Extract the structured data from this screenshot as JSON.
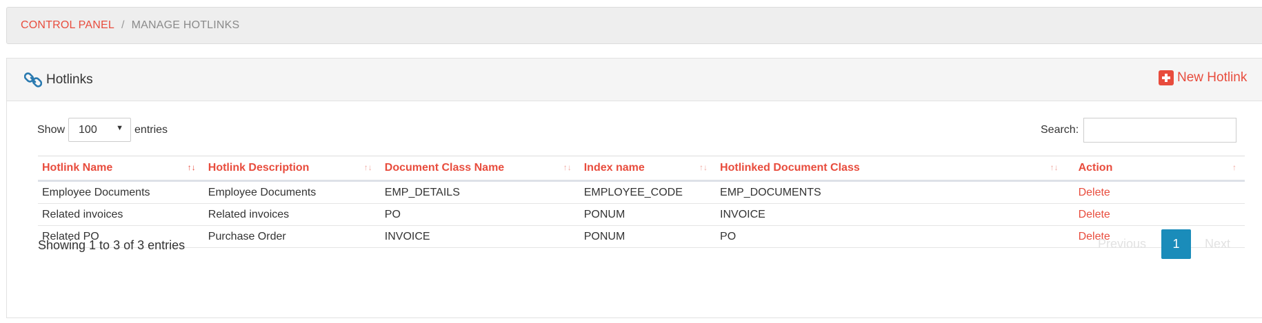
{
  "breadcrumb": {
    "root": "CONTROL PANEL",
    "separator": "/",
    "current": "MANAGE HOTLINKS"
  },
  "panel": {
    "title": "Hotlinks",
    "title_icon": "link-icon",
    "new_button": "New Hotlink",
    "new_button_icon": "plus-square-icon"
  },
  "length": {
    "show_label": "Show",
    "value": "100",
    "entries_label": "entries"
  },
  "search": {
    "label": "Search:",
    "value": ""
  },
  "table": {
    "columns": [
      "Hotlink Name",
      "Hotlink Description",
      "Document Class Name",
      "Index name",
      "Hotlinked Document Class",
      "Action"
    ],
    "rows": [
      {
        "name": "Employee Documents",
        "description": "Employee Documents",
        "doc_class": "EMP_DETAILS",
        "index": "EMPLOYEE_CODE",
        "linked_class": "EMP_DOCUMENTS",
        "action": "Delete"
      },
      {
        "name": "Related invoices",
        "description": "Related invoices",
        "doc_class": "PO",
        "index": "PONUM",
        "linked_class": "INVOICE",
        "action": "Delete"
      },
      {
        "name": "Related PO",
        "description": "Purchase Order",
        "doc_class": "INVOICE",
        "index": "PONUM",
        "linked_class": "PO",
        "action": "Delete"
      }
    ]
  },
  "footer": {
    "info": "Showing 1 to 3 of 3 entries",
    "previous": "Previous",
    "current_page": "1",
    "next": "Next"
  },
  "colors": {
    "accent": "#e84c3d",
    "page_active": "#1a8cba",
    "link_icon": "#2a7ab0"
  }
}
